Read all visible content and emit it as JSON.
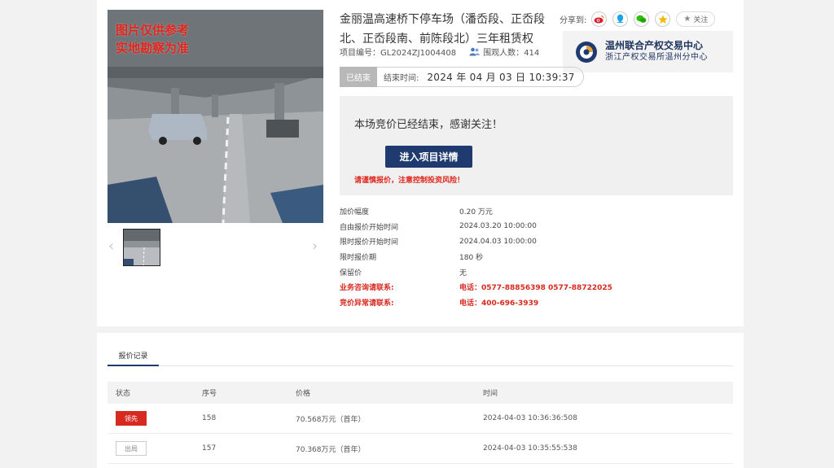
{
  "project": {
    "watermark_line1": "图片仅供参考",
    "watermark_line2": "实地勘察为准",
    "title": "金丽温高速桥下停车场（潘岙段、正岙段北、正岙段南、前陈段北）三年租赁权",
    "code_label": "项目编号：GL2024ZJ1004408",
    "views_label": "围观人数：414"
  },
  "share": {
    "label": "分享到:",
    "icons": [
      "weibo-icon",
      "qq-icon",
      "wechat-icon",
      "qzone-icon"
    ],
    "follow_label": "关注"
  },
  "org": {
    "name": "温州联合产权交易中心",
    "sub": "浙江产权交易所温州分中心"
  },
  "status": {
    "tag": "已结束",
    "end_label": "结束时间:",
    "end_value": "2024 年 04 月 03 日 10:39:37"
  },
  "end_box": {
    "message": "本场竞价已经结束，感谢关注！",
    "detail_button": "进入项目详情",
    "risk_warning": "请谨慎报价，注意控制投资风险！"
  },
  "info": [
    {
      "k": "加价幅度",
      "v": "0.20 万元",
      "red": false
    },
    {
      "k": "自由报价开始时间",
      "v": "2024.03.20 10:00:00",
      "red": false
    },
    {
      "k": "限时报价开始时间",
      "v": "2024.04.03 10:00:00",
      "red": false
    },
    {
      "k": "限时报价期",
      "v": "180 秒",
      "red": false
    },
    {
      "k": "保留价",
      "v": "无",
      "red": false
    },
    {
      "k": "业务咨询请联系:",
      "v": "电话：0577-88856398 0577-88722025",
      "red": true
    },
    {
      "k": "竞价异常请联系:",
      "v": "电话：400-696-3939",
      "red": true
    }
  ],
  "records": {
    "tab": "报价记录",
    "headers": [
      "状态",
      "序号",
      "价格",
      "时间"
    ],
    "rows": [
      {
        "status": "领先",
        "lead": true,
        "seq": "158",
        "price": "70.568万元（首年）",
        "time": "2024-04-03 10:36:36:508"
      },
      {
        "status": "出局",
        "lead": false,
        "seq": "157",
        "price": "70.368万元（首年）",
        "time": "2024-04-03 10:35:55:538"
      }
    ]
  },
  "colors": {
    "primary": "#1e3a6e",
    "warning": "#d62a20",
    "muted_tag": "#b8b8b8"
  }
}
